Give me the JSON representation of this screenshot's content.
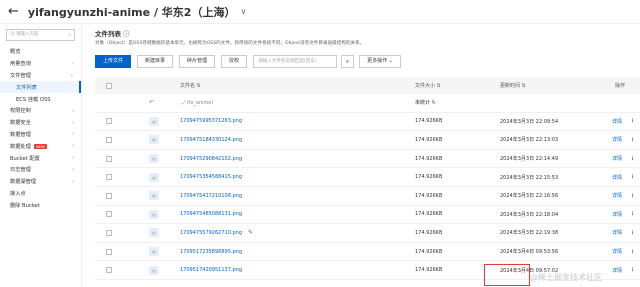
{
  "header": {
    "title": "yifangyunzhi-anime / 华东2（上海）"
  },
  "sidebar": {
    "search_placeholder": "Q 请输入内容",
    "items": [
      {
        "label": "概览"
      },
      {
        "label": "用量查询"
      },
      {
        "label": "文件管理"
      },
      {
        "label": "文件列表"
      },
      {
        "label": "ECS 挂载 OSS"
      },
      {
        "label": "权限控制"
      },
      {
        "label": "数据安全"
      },
      {
        "label": "数据管理"
      },
      {
        "label": "数据处理",
        "badge": "NEW"
      },
      {
        "label": "Bucket 配置"
      },
      {
        "label": "日志管理"
      },
      {
        "label": "数据湖管理"
      },
      {
        "label": "接入点"
      },
      {
        "label": "删除 Bucket"
      }
    ]
  },
  "main": {
    "title": "文件列表",
    "help_icon": "help-icon",
    "description": "对象（Object）是OSS存储数据的基本单元，也被称为OSS的文件。和传统的文件系统不同，Object没有文件目录层级结构的关系。",
    "toolbar": {
      "upload": "上传文件",
      "new_dir": "新建目录",
      "fragments": "碎片管理",
      "authorize": "授权",
      "search_placeholder": "请输入文件名前缀匹配(回车)",
      "more": "更多操作"
    },
    "columns": {
      "name": "文件名 ⇅",
      "size": "文件大小 ⇅",
      "time": "更新时间 ⇅",
      "ops": "操作"
    },
    "parent_row": {
      "path": "../ (to_anime)",
      "size": "未统计 ↻"
    },
    "files": [
      {
        "name": "1709475995371263.png",
        "size": "174.926KB",
        "time": "2024年3月3日 22:09:54",
        "action": "详情"
      },
      {
        "name": "1709475184330124.png",
        "size": "174.926KB",
        "time": "2024年3月3日 22:13:03",
        "action": "详情"
      },
      {
        "name": "1709475290842102.png",
        "size": "174.926KB",
        "time": "2024年3月3日 22:14:49",
        "action": "详情"
      },
      {
        "name": "1709475354588415.png",
        "size": "174.926KB",
        "time": "2024年3月3日 22:15:53",
        "action": "详情"
      },
      {
        "name": "1709475417210108.png",
        "size": "174.926KB",
        "time": "2024年3月3日 22:16:56",
        "action": "详情"
      },
      {
        "name": "1709475485088131.png",
        "size": "174.926KB",
        "time": "2024年3月3日 22:18:04",
        "action": "详情"
      },
      {
        "name": "1709475579262710.png",
        "size": "174.926KB",
        "time": "2024年3月3日 22:19:38",
        "action": "详情"
      },
      {
        "name": "1709517235898895.png",
        "size": "174.926KB",
        "time": "2024年3月4日 09:53:56",
        "action": "详情"
      },
      {
        "name": "1709517420951137.png",
        "size": "174.926KB",
        "time": "2024年3月4日 09:57:02",
        "action": "详情"
      }
    ]
  },
  "watermark": "@稀土掘金技术社区"
}
